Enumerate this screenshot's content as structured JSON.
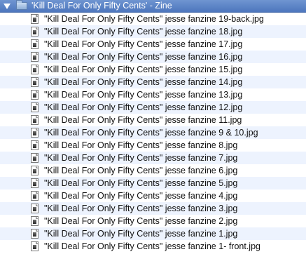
{
  "folder": {
    "name": "'Kill Deal For Only Fifty Cents' - Zine",
    "icon": "folder-icon",
    "disclosure_icon": "disclosure-triangle-expanded-icon",
    "selection_color": "#5a82c6"
  },
  "files": [
    "\"Kill Deal For Only Fifty Cents\" jesse fanzine 19-back.jpg",
    "\"Kill Deal For Only Fifty Cents\" jesse fanzine 18.jpg",
    "\"Kill Deal For Only Fifty Cents\" jesse fanzine 17.jpg",
    "\"Kill Deal For Only Fifty Cents\" jesse fanzine 16.jpg",
    "\"Kill Deal For Only Fifty Cents\" jesse fanzine 15.jpg",
    "\"Kill Deal For Only Fifty Cents\" jesse fanzine 14.jpg",
    "\"Kill Deal For Only Fifty Cents\" jesse fanzine 13.jpg",
    "\"Kill Deal For Only Fifty Cents\" jesse fanzine 12.jpg",
    "\"Kill Deal For Only Fifty Cents\" jesse fanzine 11.jpg",
    "\"Kill Deal For Only Fifty Cents\" jesse fanzine 9 & 10.jpg",
    "\"Kill Deal For Only Fifty Cents\" jesse fanzine 8.jpg",
    "\"Kill Deal For Only Fifty Cents\" jesse fanzine 7.jpg",
    "\"Kill Deal For Only Fifty Cents\" jesse fanzine 6.jpg",
    "\"Kill Deal For Only Fifty Cents\" jesse fanzine 5.jpg",
    "\"Kill Deal For Only Fifty Cents\" jesse fanzine 4.jpg",
    "\"Kill Deal For Only Fifty Cents\" jesse fanzine 3.jpg",
    "\"Kill Deal For Only Fifty Cents\" jesse fanzine 2.jpg",
    "\"Kill Deal For Only Fifty Cents\" jesse fanzine 1.jpg",
    "\"Kill Deal For Only Fifty Cents\" jesse fanzine 1- front.jpg"
  ],
  "file_icon": "jpeg-file-icon",
  "stripe_color": "#edf3fe"
}
